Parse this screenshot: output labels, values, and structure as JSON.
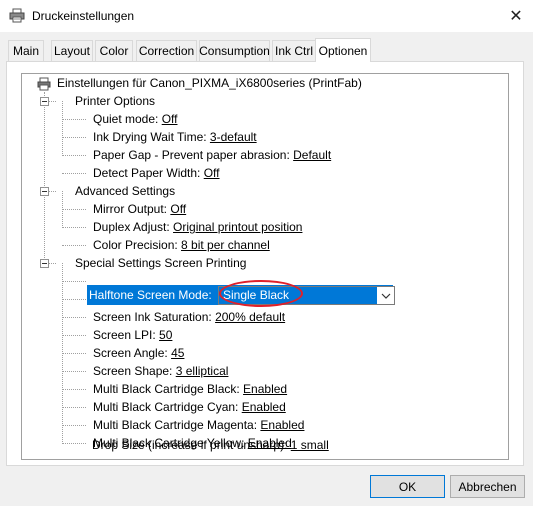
{
  "window": {
    "title": "Druckeinstellungen",
    "close": "✕"
  },
  "tabs": [
    "Main",
    "Layout",
    "Color",
    "Correction",
    "Consumption",
    "Ink Ctrl",
    "Optionen"
  ],
  "active_tab": "Optionen",
  "tree": {
    "root": "Einstellungen für Canon_PIXMA_iX6800series (PrintFab)",
    "groups": [
      {
        "label": "Printer Options",
        "items": [
          {
            "label": "Quiet mode: ",
            "value": "Off"
          },
          {
            "label": "Ink Drying Wait Time: ",
            "value": "3-default"
          },
          {
            "label": "Paper Gap - Prevent paper abrasion: ",
            "value": "Default"
          },
          {
            "label": "Detect Paper Width: ",
            "value": "Off"
          }
        ]
      },
      {
        "label": "Advanced Settings",
        "items": [
          {
            "label": "Mirror Output: ",
            "value": "Off"
          },
          {
            "label": "Duplex Adjust: ",
            "value": "Original printout position"
          },
          {
            "label": "Color Precision: ",
            "value": "8 bit per channel"
          }
        ]
      },
      {
        "label": "Special Settings Screen Printing",
        "selected_label": "Halftone Screen Mode:",
        "selected_value": "Single Black",
        "items": [
          {
            "label": "Screen Ink Saturation: ",
            "value": "200% default"
          },
          {
            "label": "Screen LPI: ",
            "value": "50"
          },
          {
            "label": "Screen Angle: ",
            "value": "45"
          },
          {
            "label": "Screen Shape: ",
            "value": "3 elliptical"
          },
          {
            "label": "Multi Black Cartridge Black: ",
            "value": "Enabled"
          },
          {
            "label": "Multi Black Cartridge Cyan: ",
            "value": "Enabled"
          },
          {
            "label": "Multi Black Cartridge Magenta: ",
            "value": "Enabled"
          },
          {
            "label": "Multi Black Cartridge Yellow: ",
            "value": "Enabled"
          },
          {
            "label": "Drop Size (increase if print unsharp): ",
            "value": "1 small"
          }
        ]
      }
    ]
  },
  "buttons": {
    "ok": "OK",
    "cancel": "Abbrechen"
  },
  "colors": {
    "selection": "#0078d7",
    "annotation": "#e0202a"
  }
}
